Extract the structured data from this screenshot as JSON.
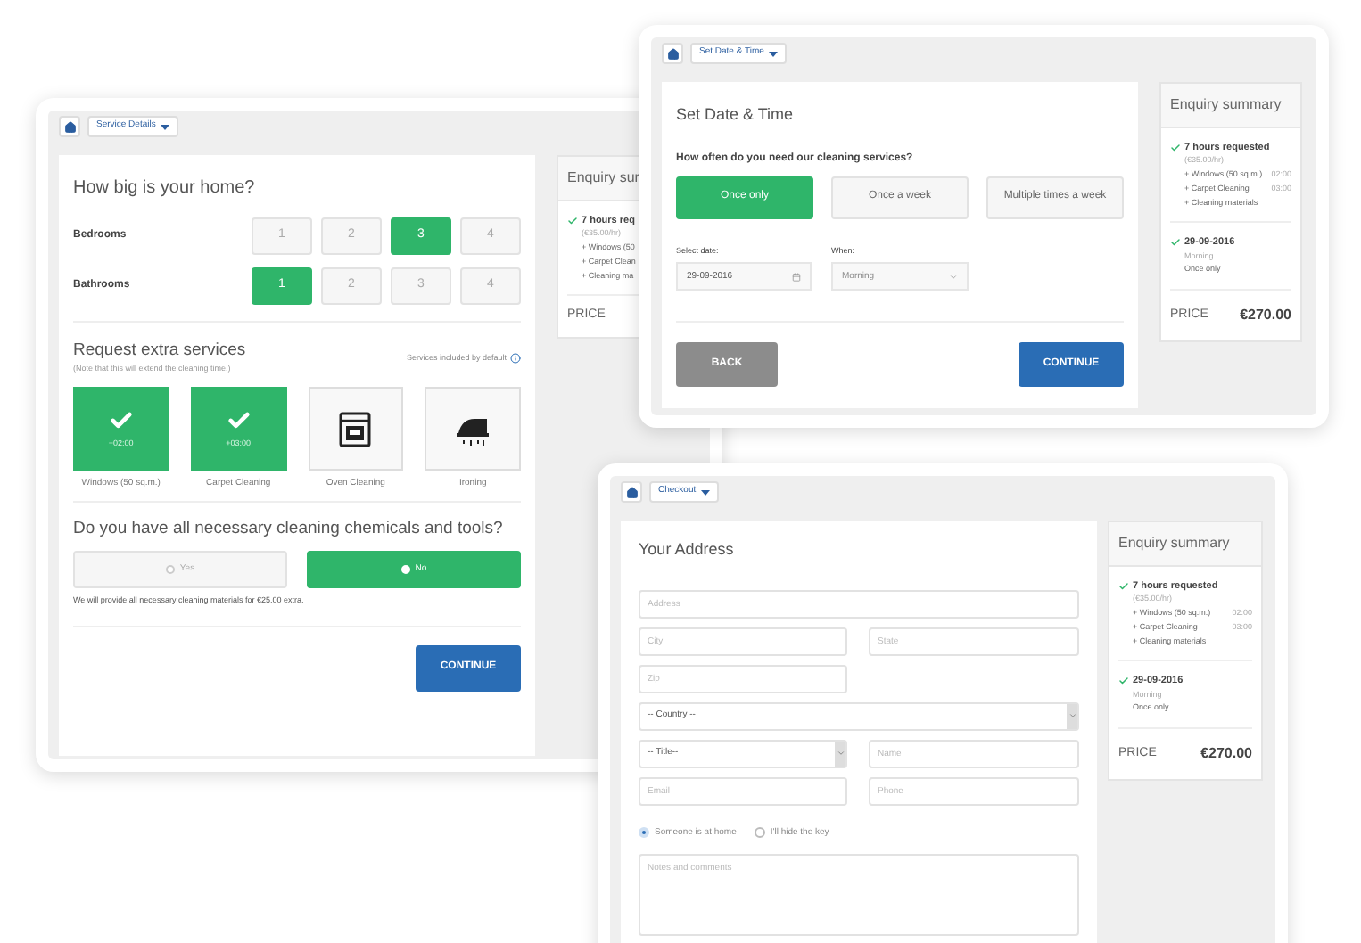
{
  "service_window": {
    "breadcrumb": "Service Details",
    "title": "How big is your home?",
    "room_rows": [
      {
        "label": "Bedrooms",
        "options": [
          {
            "label": "1",
            "selected": false
          },
          {
            "label": "2",
            "selected": false
          },
          {
            "label": "3",
            "selected": true
          },
          {
            "label": "4",
            "selected": false
          }
        ]
      },
      {
        "label": "Bathrooms",
        "options": [
          {
            "label": "1",
            "selected": true
          },
          {
            "label": "2",
            "selected": false
          },
          {
            "label": "3",
            "selected": false
          },
          {
            "label": "4",
            "selected": false
          }
        ]
      }
    ],
    "extras": {
      "title": "Request extra services",
      "note": "(Note that this will extend the cleaning time.)",
      "info_label": "Services included by default",
      "items": [
        {
          "label": "Windows (50 sq.m.)",
          "selected": true,
          "time": "+02:00"
        },
        {
          "label": "Carpet Cleaning",
          "selected": true,
          "time": "+03:00"
        },
        {
          "label": "Oven Cleaning",
          "selected": false,
          "kind": "oven"
        },
        {
          "label": "Ironing",
          "selected": false,
          "kind": "iron"
        }
      ]
    },
    "chemicals": {
      "question": "Do you have all necessary cleaning chemicals and tools?",
      "options": [
        {
          "label": "Yes",
          "selected": false
        },
        {
          "label": "No",
          "selected": true
        }
      ],
      "note": "We will provide all necessary cleaning materials for €25.00 extra."
    },
    "continue": "CONTINUE",
    "summary": {
      "title": "Enquiry sur",
      "blocks": [
        {
          "heading": "7 hours req",
          "note": "(€35.00/hr)",
          "lines": [
            {
              "text": "+ Windows (50"
            },
            {
              "text": "+ Carpet Clean"
            },
            {
              "text": "+ Cleaning ma"
            }
          ]
        }
      ],
      "price_label": "PRICE"
    }
  },
  "date_window": {
    "breadcrumb": "Set Date & Time",
    "title": "Set Date & Time",
    "question": "How often do you need our cleaning services?",
    "frequency": [
      {
        "label": "Once only",
        "selected": true
      },
      {
        "label": "Once a week",
        "selected": false
      },
      {
        "label": "Multiple times a week",
        "selected": false
      }
    ],
    "date_label": "Select date:",
    "date_value": "29-09-2016",
    "when_label": "When:",
    "when_value": "Morning",
    "back": "BACK",
    "continue": "CONTINUE",
    "summary": {
      "title": "Enquiry summary",
      "blocks": [
        {
          "heading": "7 hours requested",
          "note": "(€35.00/hr)",
          "lines": [
            {
              "text": "+ Windows (50 sq.m.)",
              "time": "02:00"
            },
            {
              "text": "+ Carpet Cleaning",
              "time": "03:00"
            },
            {
              "text": "+ Cleaning materials"
            }
          ]
        },
        {
          "heading": "29-09-2016",
          "note": "Morning",
          "lines": [
            {
              "text": "Once only"
            }
          ]
        }
      ],
      "price_label": "PRICE",
      "price": "€270.00"
    }
  },
  "checkout_window": {
    "breadcrumb": "Checkout",
    "title": "Your Address",
    "address": {
      "placeholder": "Address"
    },
    "city": {
      "placeholder": "City"
    },
    "state": {
      "placeholder": "State"
    },
    "zip": {
      "placeholder": "Zip"
    },
    "country": {
      "value": "-- Country --"
    },
    "person_title": {
      "value": "-- Title--"
    },
    "name": {
      "placeholder": "Name"
    },
    "email": {
      "placeholder": "Email"
    },
    "phone": {
      "placeholder": "Phone"
    },
    "presence": [
      {
        "label": "Someone is at home",
        "selected": true
      },
      {
        "label": "I'll hide the key",
        "selected": false
      }
    ],
    "notes": {
      "placeholder": "Notes and comments"
    },
    "summary": {
      "title": "Enquiry summary",
      "blocks": [
        {
          "heading": "7 hours requested",
          "note": "(€35.00/hr)",
          "lines": [
            {
              "text": "+ Windows (50 sq.m.)",
              "time": "02:00"
            },
            {
              "text": "+ Carpet Cleaning",
              "time": "03:00"
            },
            {
              "text": "+ Cleaning materials"
            }
          ]
        },
        {
          "heading": "29-09-2016",
          "note": "Morning",
          "lines": [
            {
              "text": "Once only"
            }
          ]
        }
      ],
      "price_label": "PRICE",
      "price": "€270.00"
    }
  }
}
